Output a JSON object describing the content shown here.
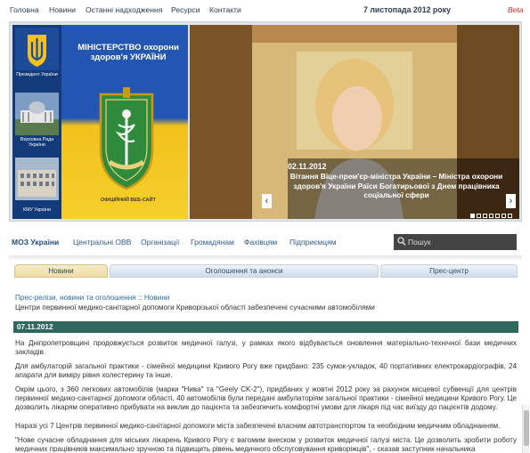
{
  "top_nav": {
    "items": [
      "Головна",
      "Новини",
      "Останні надходження",
      "Ресурси",
      "Контакти"
    ],
    "date": "7 листопада 2012 року",
    "beta": "Beta"
  },
  "banner": {
    "side_links": [
      {
        "label": "Президент України"
      },
      {
        "label": "Верховна Рада України"
      },
      {
        "label": "КМУ України"
      }
    ],
    "ministry_title": "МІНІСТЕРСТВО охорони здоров'я УКРАЇНИ",
    "emblem_text": "МІНІСТЕРСТВО ОХОРОНИ ЗДОРОВ'Я",
    "official_site": "ОФІЦІЙНИЙ ВЕБ-САЙТ",
    "slide": {
      "date": "02.11.2012",
      "text": "Вітання Віце-прем'єр-міністра України – Міністра охорони здоров'я України Раїси Богатирьової з Днем працівника соціальної сфери",
      "dot_count": 8,
      "active_dot": 0
    }
  },
  "section_nav": {
    "items": [
      "МОЗ України",
      "Центральні ОВВ",
      "Організації",
      "Громадянам",
      "Фахівцям",
      "Підприємцям"
    ],
    "search_placeholder": "Пошук"
  },
  "tabs": [
    "Новини",
    "Оголошення та анонси",
    "Прес-центр"
  ],
  "breadcrumb": {
    "parent": "Прес-релізи, новини та оголошення",
    "separator": "::",
    "current": "Новини"
  },
  "article": {
    "title": "Центри первинної медико-санітарної допомоги Криворізької області забезпечені сучасними автомобілями",
    "date": "07.11.2012",
    "paragraphs": [
      "На Дніпропетровщині продовжується розвиток медичної галузі, у рамках якого відбувається оновлення матеріально-технічної бази медичних закладів.",
      "Для амбулаторій загальної практики - сімейної медицини Кривого Рогу вже придбано: 235 сумок-укладок, 40 портативних електрокардіографів, 24 апарати для виміру рівня холестерину та інше.",
      "Окрім цього, з 360 легкових автомобілів (марки \"Нива\" та \"Geely CK-2\"), придбаних у жовтні 2012 року за рахунок місцевої субвенції для центрів первинної медико-санітарної допомоги області, 40 автомобілів були передані амбулаторіям загальної практики - сімейної медицини Кривого Рогу. Це дозволить лікарям оперативно прибувати на виклик до пацієнта та забезпечить комфортні умови для лікаря під час виїзду до пацієнтів додому.",
      "Наразі усі 7 Центрів первинної медико-санітарної допомоги міста забезпечені власним автотранспортом та необхідним медичним обладнанням.",
      "\"Нове сучасне обладнання для міських лікарень Кривого Рогу є вагомим внеском у розвиток медичної галузі міста. Це дозволить зробити роботу медичних працівників максимально зручною та підвищить рівень медичного обслуговування криворіжців\", - сказав заступник начальника"
    ]
  },
  "colors": {
    "nav_text": "#2d3d52",
    "beta": "#c9302c",
    "link": "#2d6aa0",
    "date_bar": "#2f6860",
    "flag_blue": "#2356b2",
    "flag_yellow": "#f2c11c",
    "side_panel": "#133a7a"
  }
}
